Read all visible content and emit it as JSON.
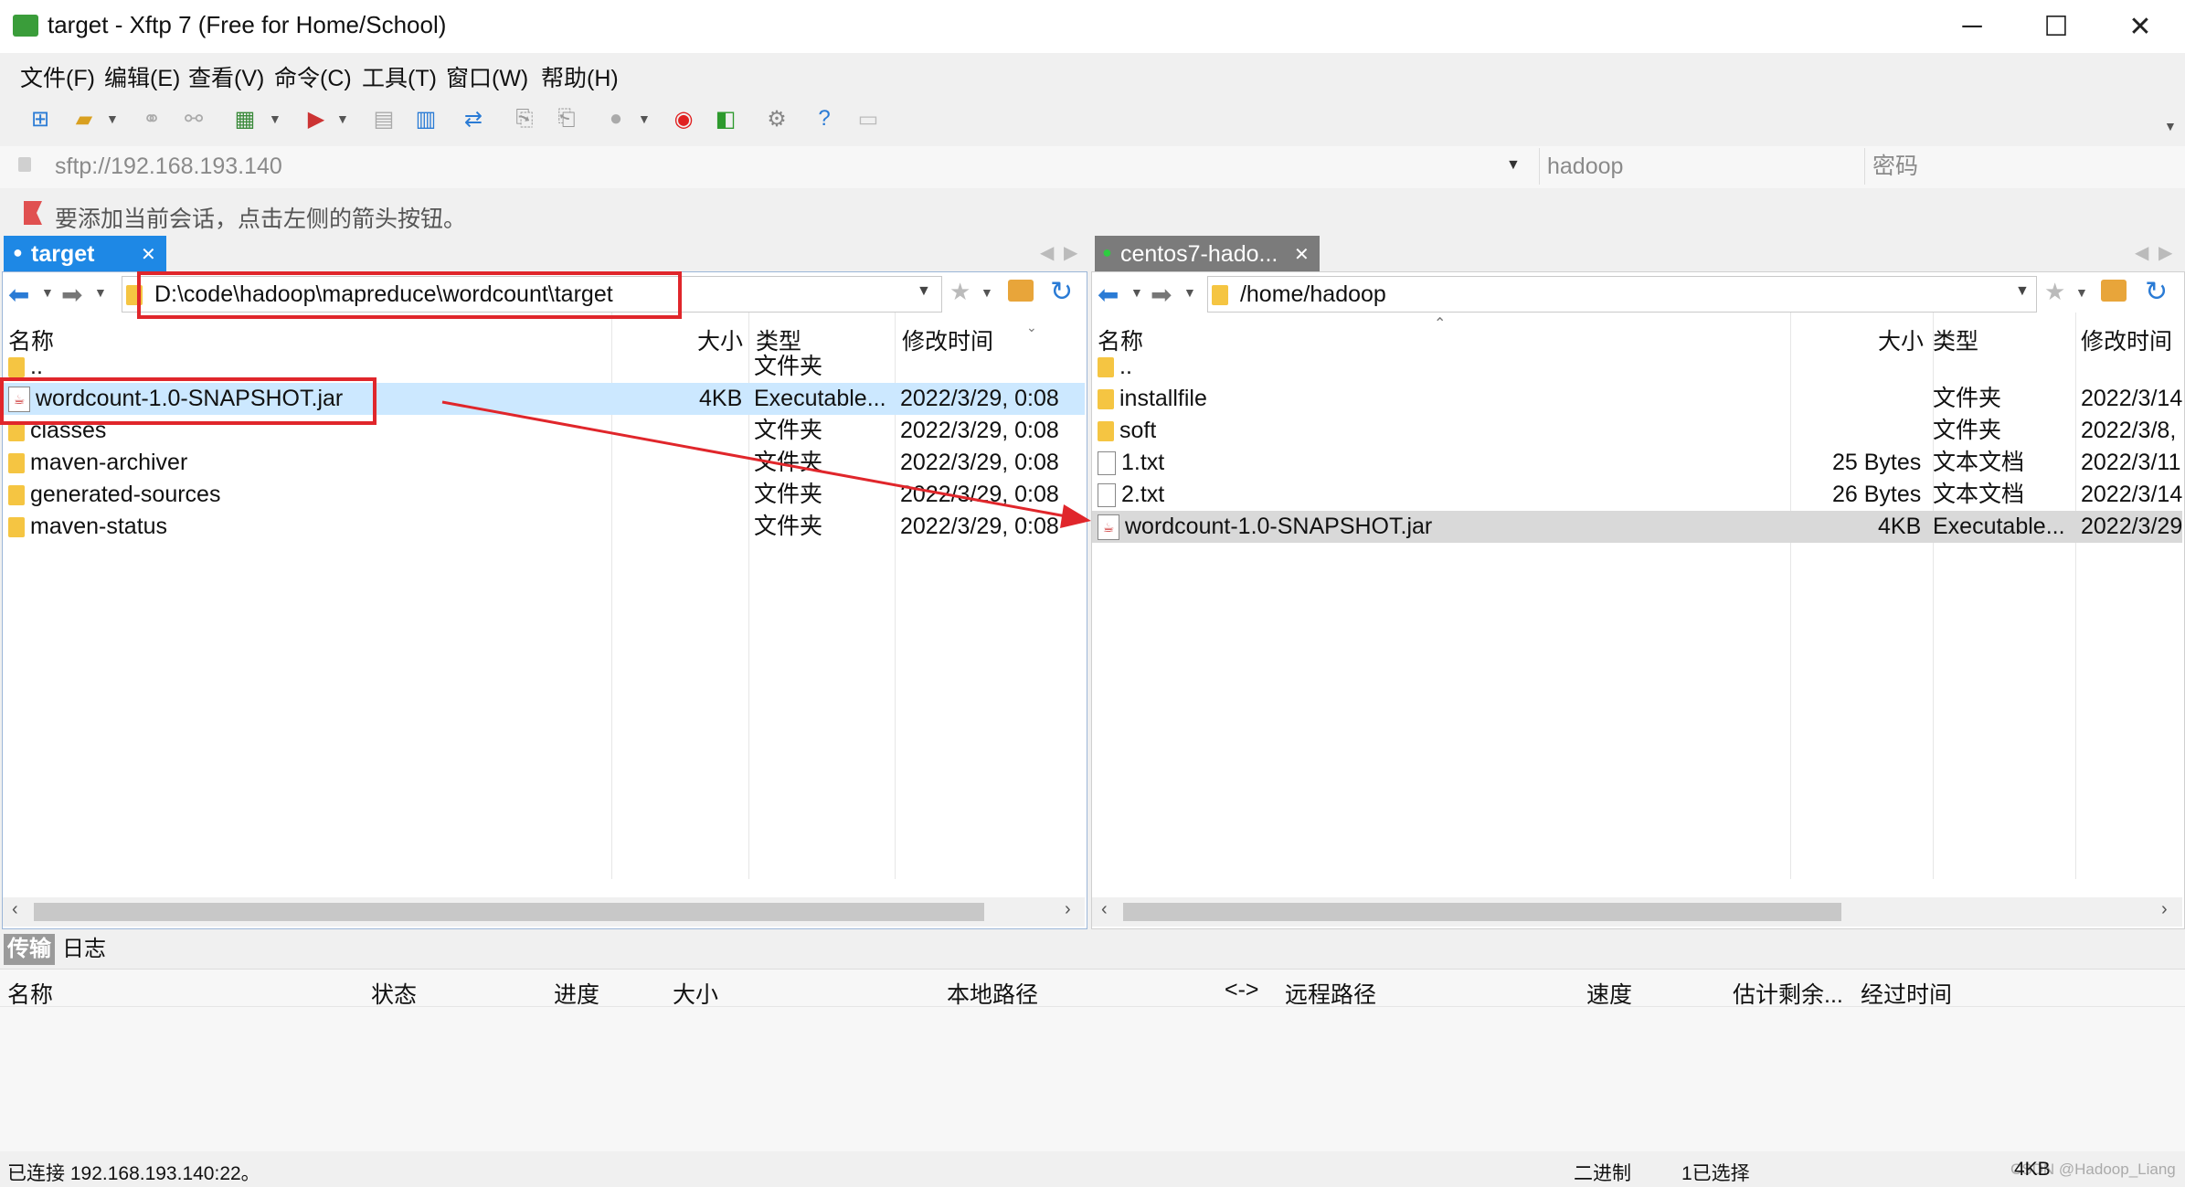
{
  "window": {
    "title": "target - Xftp 7 (Free for Home/School)",
    "minimize": "─",
    "maximize": "☐",
    "close": "✕"
  },
  "menu": [
    "文件(F)",
    "编辑(E)",
    "查看(V)",
    "命令(C)",
    "工具(T)",
    "窗口(W)",
    "帮助(H)"
  ],
  "address": {
    "url": "sftp://192.168.193.140",
    "user": "hadoop",
    "password_placeholder": "密码"
  },
  "hint": "要添加当前会话，点击左侧的箭头按钮。",
  "left": {
    "tab": "target",
    "path": "D:\\code\\hadoop\\mapreduce\\wordcount\\target",
    "columns": [
      "名称",
      "大小",
      "类型",
      "修改时间"
    ],
    "rows": [
      {
        "name": "..",
        "size": "",
        "type": "文件夹",
        "date": "",
        "icon": "folder-icon"
      },
      {
        "name": "wordcount-1.0-SNAPSHOT.jar",
        "size": "4KB",
        "type": "Executable...",
        "date": "2022/3/29, 0:08",
        "icon": "jar-icon"
      },
      {
        "name": "classes",
        "size": "",
        "type": "文件夹",
        "date": "2022/3/29, 0:08",
        "icon": "folder-icon"
      },
      {
        "name": "maven-archiver",
        "size": "",
        "type": "文件夹",
        "date": "2022/3/29, 0:08",
        "icon": "folder-icon"
      },
      {
        "name": "generated-sources",
        "size": "",
        "type": "文件夹",
        "date": "2022/3/29, 0:08",
        "icon": "folder-icon"
      },
      {
        "name": "maven-status",
        "size": "",
        "type": "文件夹",
        "date": "2022/3/29, 0:08",
        "icon": "folder-icon"
      }
    ]
  },
  "right": {
    "tab": "centos7-hado...",
    "path": "/home/hadoop",
    "columns": [
      "名称",
      "大小",
      "类型",
      "修改时间"
    ],
    "rows": [
      {
        "name": "..",
        "size": "",
        "type": "",
        "date": "",
        "icon": "folder-icon"
      },
      {
        "name": "installfile",
        "size": "",
        "type": "文件夹",
        "date": "2022/3/14",
        "icon": "folder-icon"
      },
      {
        "name": "soft",
        "size": "",
        "type": "文件夹",
        "date": "2022/3/8,",
        "icon": "folder-icon"
      },
      {
        "name": "1.txt",
        "size": "25 Bytes",
        "type": "文本文档",
        "date": "2022/3/11",
        "icon": "text-file-icon"
      },
      {
        "name": "2.txt",
        "size": "26 Bytes",
        "type": "文本文档",
        "date": "2022/3/14",
        "icon": "text-file-icon"
      },
      {
        "name": "wordcount-1.0-SNAPSHOT.jar",
        "size": "4KB",
        "type": "Executable...",
        "date": "2022/3/29",
        "icon": "jar-icon"
      }
    ]
  },
  "transfer": {
    "tabs": [
      "传输",
      "日志"
    ],
    "columns": [
      "名称",
      "状态",
      "进度",
      "大小",
      "本地路径",
      "<->",
      "远程路径",
      "速度",
      "估计剩余...",
      "经过时间"
    ]
  },
  "status": {
    "left": "已连接 192.168.193.140:22。",
    "mode": "二进制",
    "selection": "1已选择",
    "size": "4KB",
    "watermark": "CSDN @Hadoop_Liang"
  },
  "colors": {
    "accent": "#1e88e5",
    "annotation_red": "#e0262b",
    "selected_row": "#cce8ff"
  }
}
